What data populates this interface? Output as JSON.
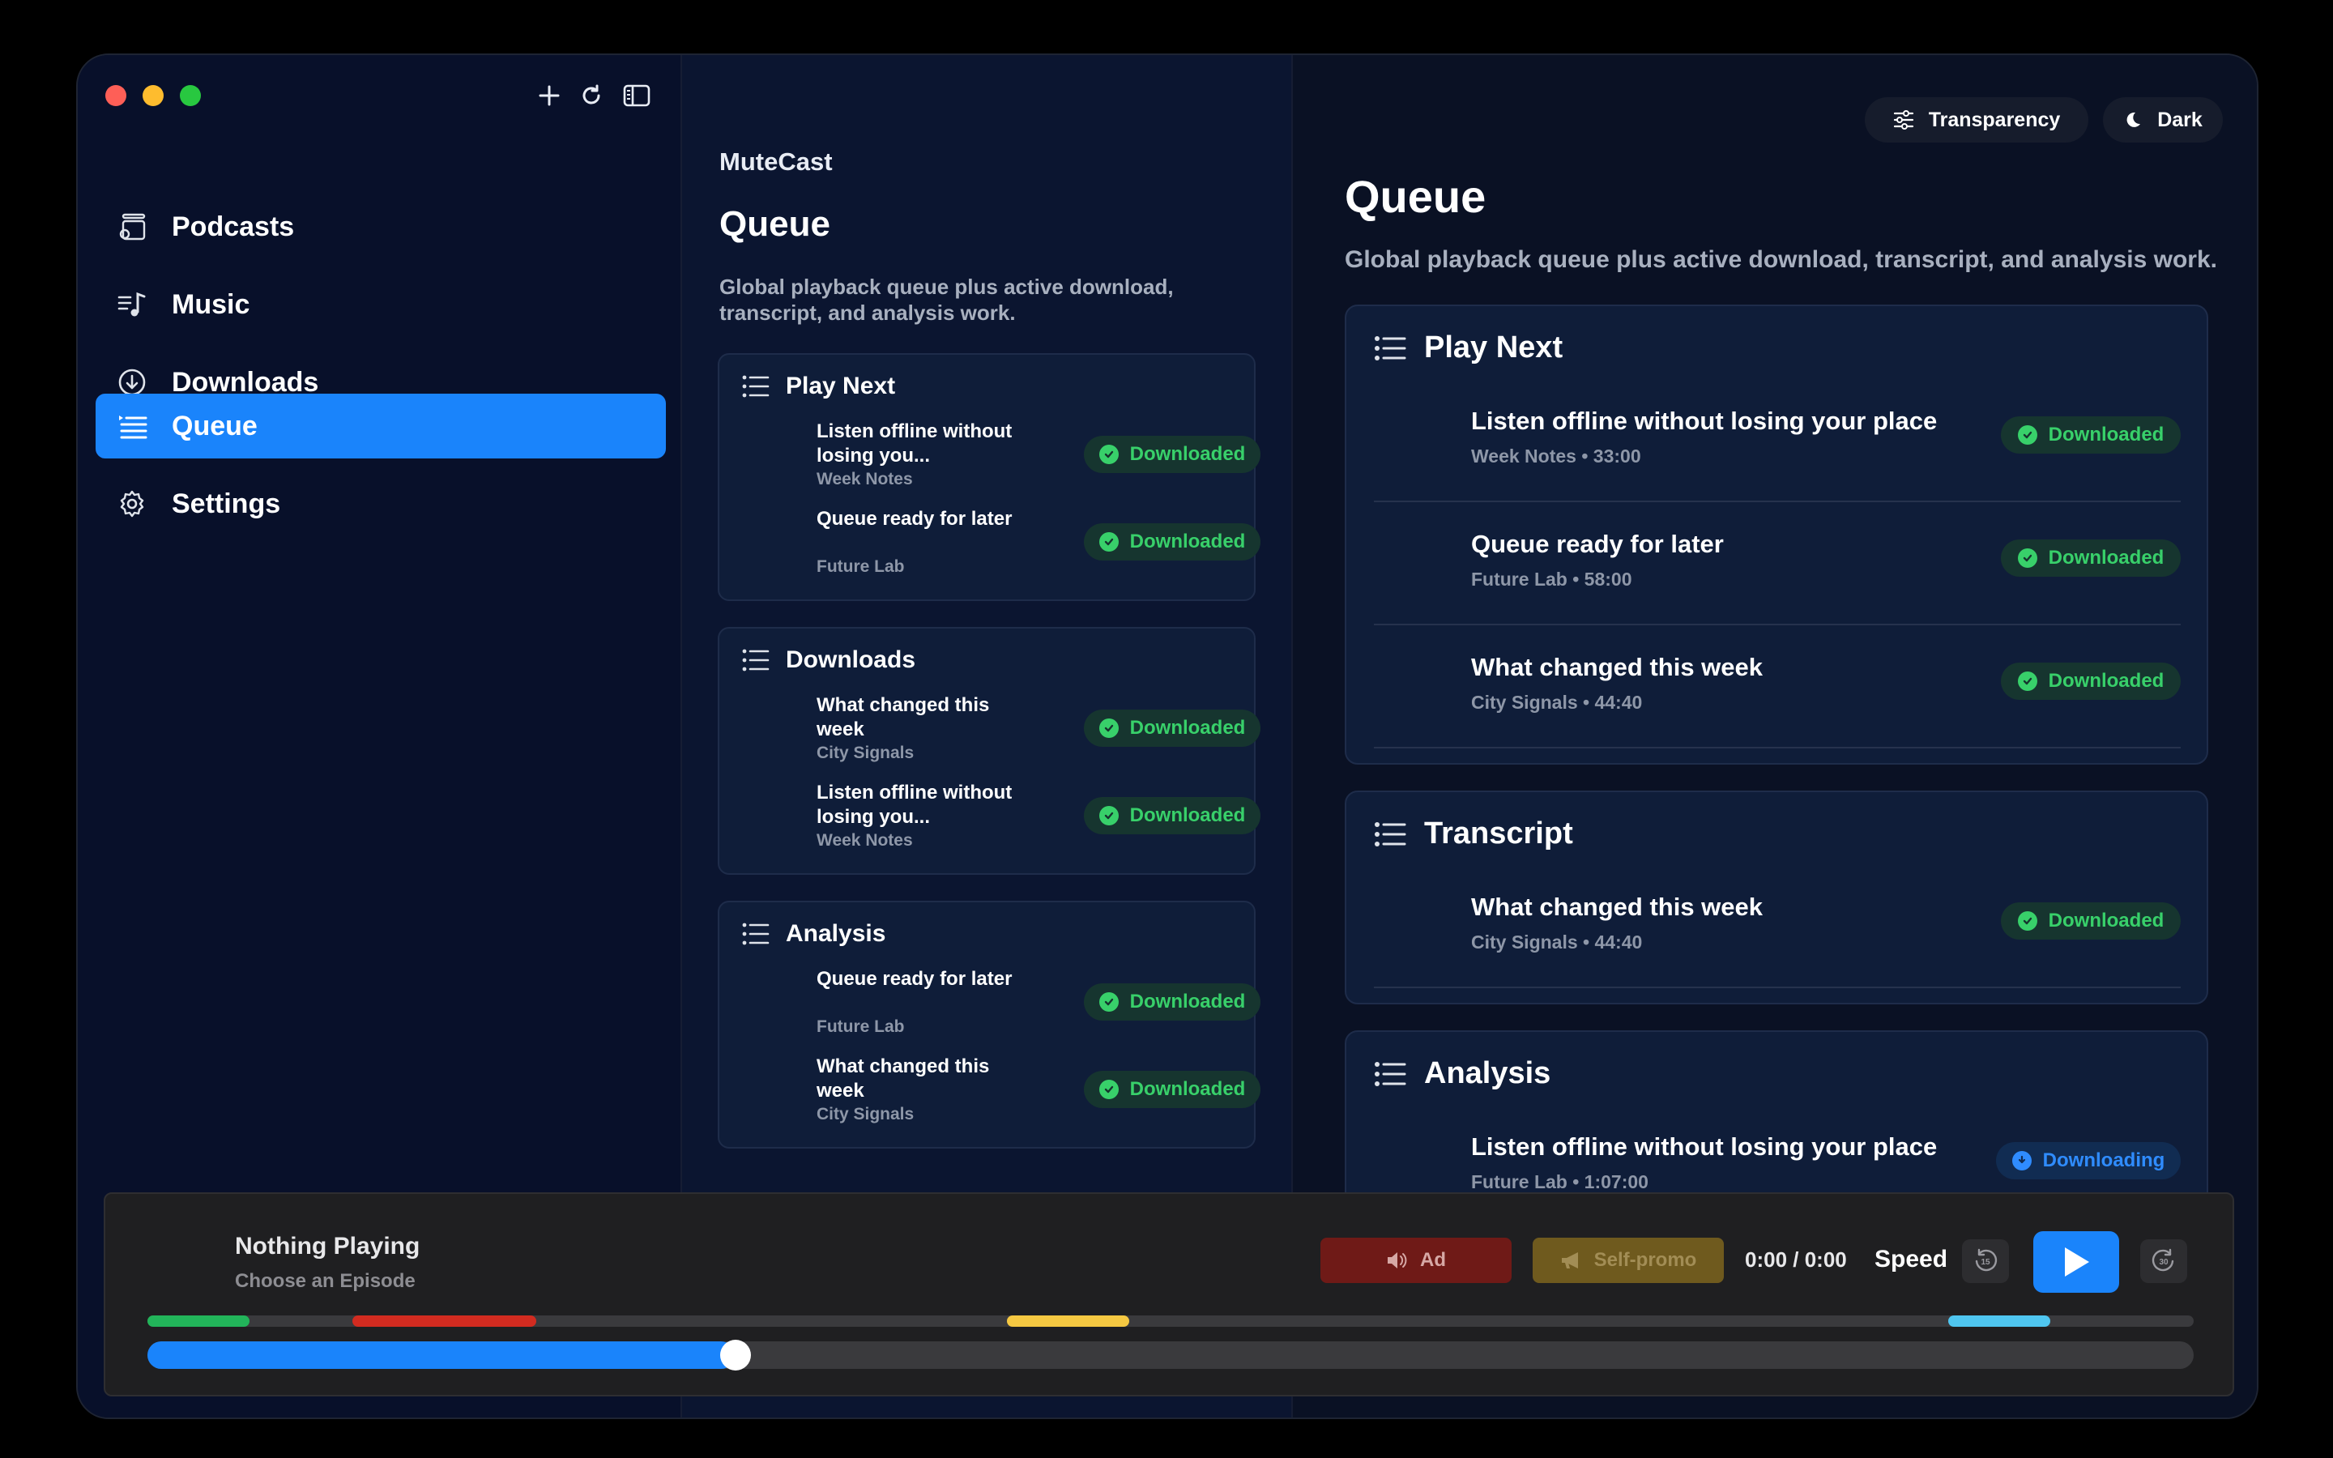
{
  "app_name": "MuteCast",
  "colors": {
    "accent": "#1a84fb",
    "downloaded": "#38d06a",
    "downloading": "#2f8cff",
    "ad": "#6f1a17",
    "self_promo": "#6f5a1e",
    "segment_green": "#22b45a",
    "segment_red": "#d22b20",
    "segment_yellow": "#f5c842",
    "segment_cyan": "#4fc6f0"
  },
  "sidebar": {
    "items": [
      {
        "label": "Podcasts",
        "icon": "podcasts-icon"
      },
      {
        "label": "Music",
        "icon": "music-icon"
      },
      {
        "label": "Downloads",
        "icon": "download-icon"
      },
      {
        "label": "Queue",
        "icon": "queue-icon",
        "active": true
      },
      {
        "label": "Settings",
        "icon": "gear-icon"
      }
    ]
  },
  "middle": {
    "app_title": "MuteCast",
    "title": "Queue",
    "description": "Global playback queue plus active download, transcript, and analysis work.",
    "sections": [
      {
        "title": "Play Next",
        "rows": [
          {
            "title": "Listen offline without losing you...",
            "subtitle": "Week Notes",
            "status": "Downloaded"
          },
          {
            "title": "Queue ready for later",
            "subtitle": "Future Lab",
            "status": "Downloaded"
          }
        ]
      },
      {
        "title": "Downloads",
        "rows": [
          {
            "title": "What changed this week",
            "subtitle": "City Signals",
            "status": "Downloaded"
          },
          {
            "title": "Listen offline without losing you...",
            "subtitle": "Week Notes",
            "status": "Downloaded"
          }
        ]
      },
      {
        "title": "Analysis",
        "rows": [
          {
            "title": "Queue ready for later",
            "subtitle": "Future Lab",
            "status": "Downloaded"
          },
          {
            "title": "What changed this week",
            "subtitle": "City Signals",
            "status": "Downloaded"
          }
        ]
      }
    ]
  },
  "right": {
    "transparency_label": "Transparency",
    "dark_label": "Dark",
    "title": "Queue",
    "description": "Global playback queue plus active download, transcript, and analysis work.",
    "sections": [
      {
        "title": "Play Next",
        "rows": [
          {
            "title": "Listen offline without losing your place",
            "subtitle": "Week Notes • 33:00",
            "status": "Downloaded"
          },
          {
            "title": "Queue ready for later",
            "subtitle": "Future Lab • 58:00",
            "status": "Downloaded"
          },
          {
            "title": "What changed this week",
            "subtitle": "City Signals • 44:40",
            "status": "Downloaded"
          }
        ]
      },
      {
        "title": "Transcript",
        "rows": [
          {
            "title": "What changed this week",
            "subtitle": "City Signals • 44:40",
            "status": "Downloaded"
          }
        ]
      },
      {
        "title": "Analysis",
        "rows": [
          {
            "title": "Listen offline without losing your place",
            "subtitle": "Future Lab • 1:07:00",
            "status": "Downloading"
          }
        ]
      }
    ]
  },
  "player": {
    "title": "Nothing Playing",
    "subtitle": "Choose an Episode",
    "ad_label": "Ad",
    "self_promo_label": "Self-promo",
    "time": "0:00 / 0:00",
    "speed_label": "Speed",
    "skip_back_seconds": "15",
    "skip_forward_seconds": "30",
    "progress_fraction": 0.28,
    "segments": [
      {
        "start": 0.0,
        "end": 0.05,
        "color": "#22b45a"
      },
      {
        "start": 0.1,
        "end": 0.19,
        "color": "#d22b20"
      },
      {
        "start": 0.42,
        "end": 0.48,
        "color": "#f5c842"
      },
      {
        "start": 0.88,
        "end": 0.93,
        "color": "#4fc6f0"
      }
    ]
  }
}
